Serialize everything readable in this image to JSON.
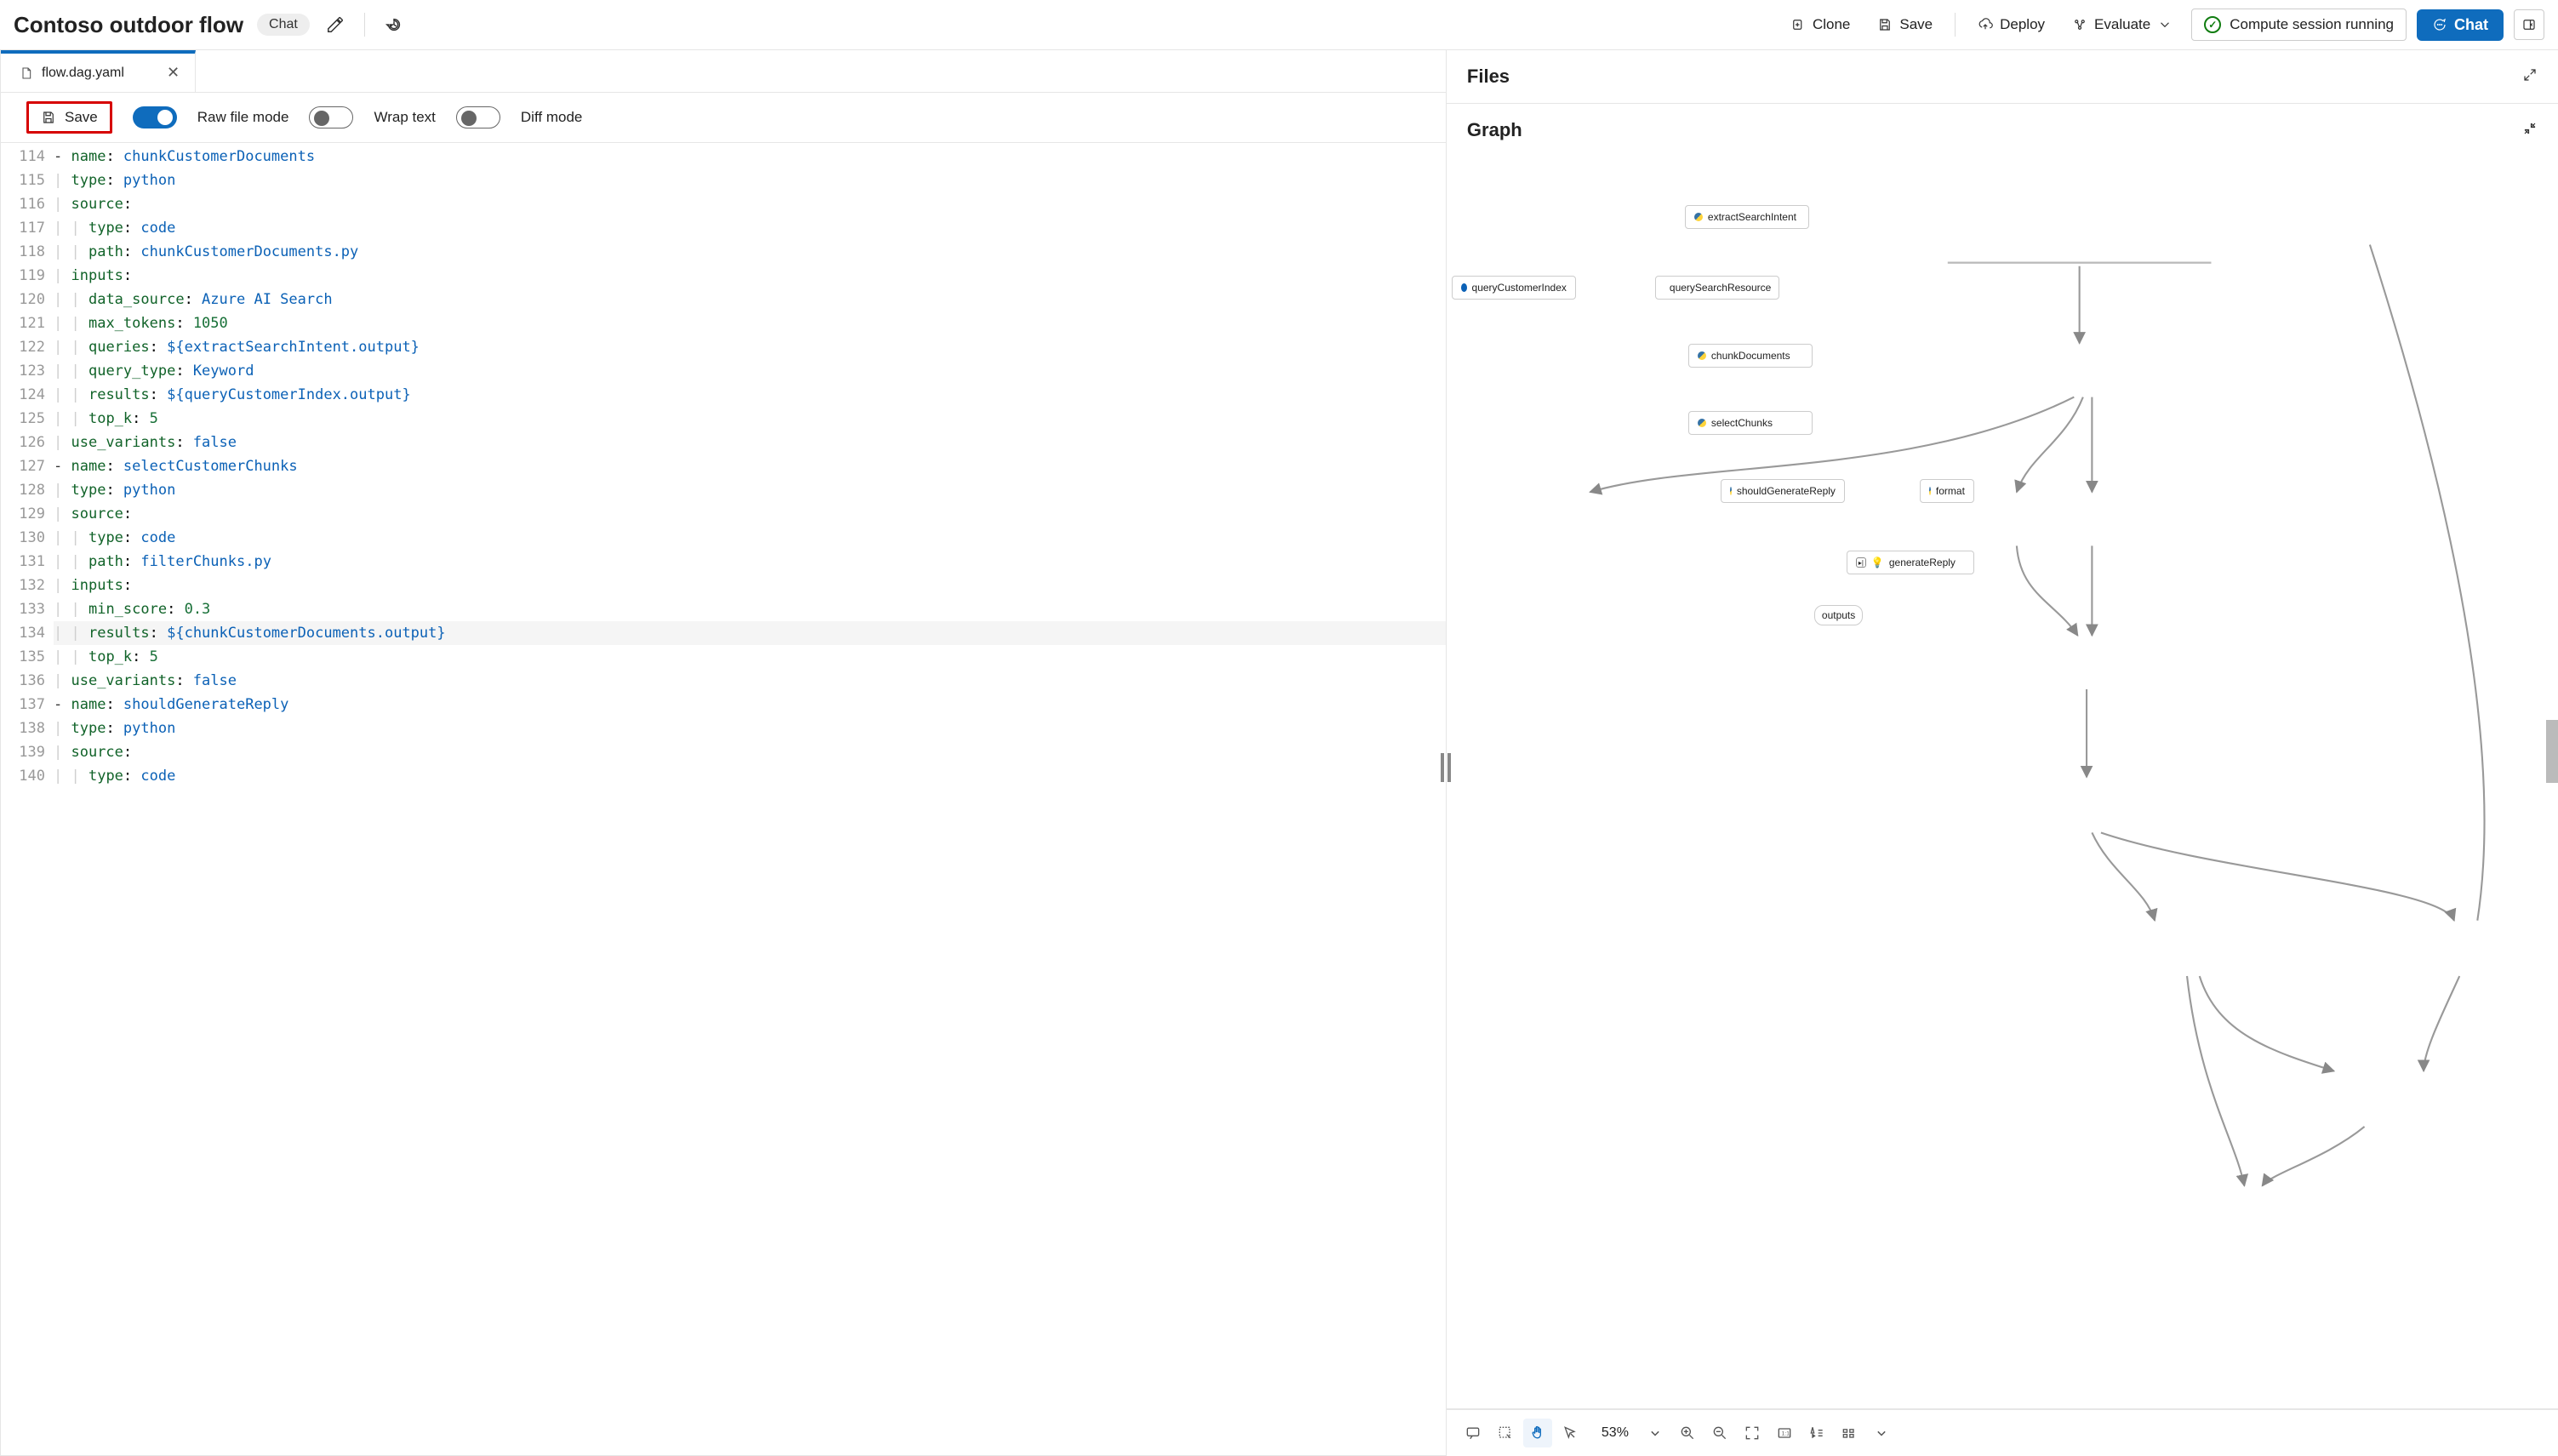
{
  "header": {
    "title": "Contoso outdoor flow",
    "badge": "Chat",
    "actions": {
      "clone": "Clone",
      "save": "Save",
      "deploy": "Deploy",
      "evaluate": "Evaluate",
      "compute": "Compute session running",
      "chat": "Chat"
    }
  },
  "tab": {
    "filename": "flow.dag.yaml"
  },
  "editor_toolbar": {
    "save": "Save",
    "raw_mode": "Raw file mode",
    "wrap_text": "Wrap text",
    "diff_mode": "Diff mode",
    "raw_mode_on": true,
    "wrap_text_on": false,
    "diff_mode_on": false
  },
  "code": {
    "first_line": 114,
    "highlight_line": 134,
    "lines": [
      [
        {
          "t": "- ",
          "c": "s-dash"
        },
        {
          "t": "name",
          "c": "s-key"
        },
        {
          "t": ": "
        },
        {
          "t": "chunkCustomerDocuments",
          "c": "s-str"
        }
      ],
      [
        {
          "t": "  "
        },
        {
          "t": "type",
          "c": "s-key"
        },
        {
          "t": ": "
        },
        {
          "t": "python",
          "c": "s-str"
        }
      ],
      [
        {
          "t": "  "
        },
        {
          "t": "source",
          "c": "s-key"
        },
        {
          "t": ":"
        }
      ],
      [
        {
          "t": "    "
        },
        {
          "t": "type",
          "c": "s-key"
        },
        {
          "t": ": "
        },
        {
          "t": "code",
          "c": "s-str"
        }
      ],
      [
        {
          "t": "    "
        },
        {
          "t": "path",
          "c": "s-key"
        },
        {
          "t": ": "
        },
        {
          "t": "chunkCustomerDocuments.py",
          "c": "s-str"
        }
      ],
      [
        {
          "t": "  "
        },
        {
          "t": "inputs",
          "c": "s-key"
        },
        {
          "t": ":"
        }
      ],
      [
        {
          "t": "    "
        },
        {
          "t": "data_source",
          "c": "s-key"
        },
        {
          "t": ": "
        },
        {
          "t": "Azure AI Search",
          "c": "s-str"
        }
      ],
      [
        {
          "t": "    "
        },
        {
          "t": "max_tokens",
          "c": "s-key"
        },
        {
          "t": ": "
        },
        {
          "t": "1050",
          "c": "s-num"
        }
      ],
      [
        {
          "t": "    "
        },
        {
          "t": "queries",
          "c": "s-key"
        },
        {
          "t": ": "
        },
        {
          "t": "${extractSearchIntent.output}",
          "c": "s-str"
        }
      ],
      [
        {
          "t": "    "
        },
        {
          "t": "query_type",
          "c": "s-key"
        },
        {
          "t": ": "
        },
        {
          "t": "Keyword",
          "c": "s-str"
        }
      ],
      [
        {
          "t": "    "
        },
        {
          "t": "results",
          "c": "s-key"
        },
        {
          "t": ": "
        },
        {
          "t": "${queryCustomerIndex.output}",
          "c": "s-str"
        }
      ],
      [
        {
          "t": "    "
        },
        {
          "t": "top_k",
          "c": "s-key"
        },
        {
          "t": ": "
        },
        {
          "t": "5",
          "c": "s-num"
        }
      ],
      [
        {
          "t": "  "
        },
        {
          "t": "use_variants",
          "c": "s-key"
        },
        {
          "t": ": "
        },
        {
          "t": "false",
          "c": "s-str"
        }
      ],
      [
        {
          "t": "- ",
          "c": "s-dash"
        },
        {
          "t": "name",
          "c": "s-key"
        },
        {
          "t": ": "
        },
        {
          "t": "selectCustomerChunks",
          "c": "s-str"
        }
      ],
      [
        {
          "t": "  "
        },
        {
          "t": "type",
          "c": "s-key"
        },
        {
          "t": ": "
        },
        {
          "t": "python",
          "c": "s-str"
        }
      ],
      [
        {
          "t": "  "
        },
        {
          "t": "source",
          "c": "s-key"
        },
        {
          "t": ":"
        }
      ],
      [
        {
          "t": "    "
        },
        {
          "t": "type",
          "c": "s-key"
        },
        {
          "t": ": "
        },
        {
          "t": "code",
          "c": "s-str"
        }
      ],
      [
        {
          "t": "    "
        },
        {
          "t": "path",
          "c": "s-key"
        },
        {
          "t": ": "
        },
        {
          "t": "filterChunks.py",
          "c": "s-str"
        }
      ],
      [
        {
          "t": "  "
        },
        {
          "t": "inputs",
          "c": "s-key"
        },
        {
          "t": ":"
        }
      ],
      [
        {
          "t": "    "
        },
        {
          "t": "min_score",
          "c": "s-key"
        },
        {
          "t": ": "
        },
        {
          "t": "0.3",
          "c": "s-num"
        }
      ],
      [
        {
          "t": "    "
        },
        {
          "t": "results",
          "c": "s-key"
        },
        {
          "t": ": "
        },
        {
          "t": "${chunkCustomerDocuments.output}",
          "c": "s-str"
        }
      ],
      [
        {
          "t": "    "
        },
        {
          "t": "top_k",
          "c": "s-key"
        },
        {
          "t": ": "
        },
        {
          "t": "5",
          "c": "s-num"
        }
      ],
      [
        {
          "t": "  "
        },
        {
          "t": "use_variants",
          "c": "s-key"
        },
        {
          "t": ": "
        },
        {
          "t": "false",
          "c": "s-str"
        }
      ],
      [
        {
          "t": "- ",
          "c": "s-dash"
        },
        {
          "t": "name",
          "c": "s-key"
        },
        {
          "t": ": "
        },
        {
          "t": "shouldGenerateReply",
          "c": "s-str"
        }
      ],
      [
        {
          "t": "  "
        },
        {
          "t": "type",
          "c": "s-key"
        },
        {
          "t": ": "
        },
        {
          "t": "python",
          "c": "s-str"
        }
      ],
      [
        {
          "t": "  "
        },
        {
          "t": "source",
          "c": "s-key"
        },
        {
          "t": ":"
        }
      ],
      [
        {
          "t": "    "
        },
        {
          "t": "type",
          "c": "s-key"
        },
        {
          "t": ": "
        },
        {
          "t": "code",
          "c": "s-str"
        }
      ]
    ]
  },
  "right": {
    "files": "Files",
    "graph": "Graph",
    "zoom": "53%",
    "nodes": {
      "extractSearchIntent": "extractSearchIntent",
      "queryCustomerIndex": "queryCustomerIndex",
      "querySearchResource": "querySearchResource",
      "chunkDocuments": "chunkDocuments",
      "selectChunks": "selectChunks",
      "shouldGenerateReply": "shouldGenerateReply",
      "format": "format",
      "generateReply": "generateReply",
      "outputs": "outputs"
    }
  }
}
